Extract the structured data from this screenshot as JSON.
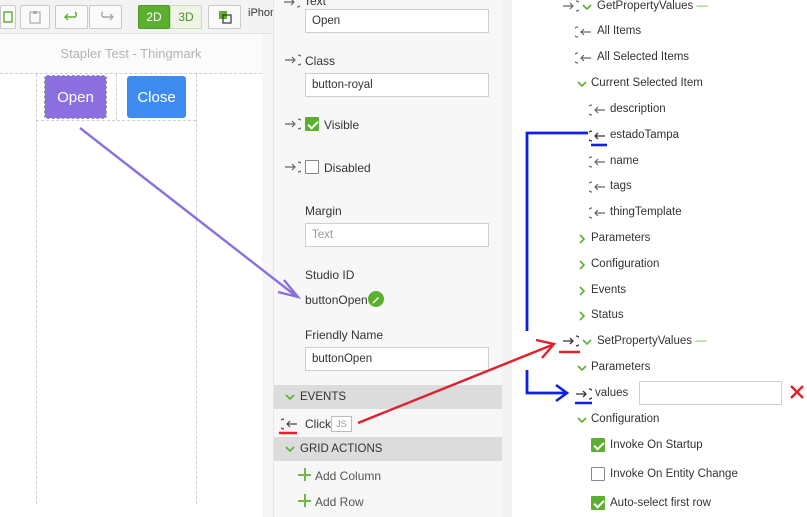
{
  "toolbar": {
    "btn_2d": "2D",
    "btn_3d": "3D",
    "device": "iPhone"
  },
  "canvas": {
    "title": "Stapler Test - Thingmark",
    "open_label": "Open",
    "close_label": "Close",
    "colors": {
      "open": "#8b6fe0",
      "close": "#3e8cf0"
    }
  },
  "properties": {
    "text_label": "Text",
    "text_value": "Open",
    "class_label": "Class",
    "class_value": "button-royal",
    "visible_label": "Visible",
    "visible_checked": true,
    "disabled_label": "Disabled",
    "disabled_checked": false,
    "margin_label": "Margin",
    "margin_placeholder": "Text",
    "studio_id_label": "Studio ID",
    "studio_id_value": "buttonOpen",
    "friendly_name_label": "Friendly Name",
    "friendly_name_value": "buttonOpen",
    "events_header": "EVENTS",
    "click_label": "Click",
    "js_badge": "JS",
    "grid_actions_header": "GRID ACTIONS",
    "add_column": "Add Column",
    "add_row": "Add Row"
  },
  "tree": {
    "get_property_values": "GetPropertyValues",
    "all_items": "All Items",
    "all_selected_items": "All Selected Items",
    "current_selected_item": "Current Selected Item",
    "fields": [
      "description",
      "estadoTampa",
      "name",
      "tags",
      "thingTemplate"
    ],
    "parameters": "Parameters",
    "configuration": "Configuration",
    "events": "Events",
    "status": "Status",
    "set_property_values": "SetPropertyValues",
    "set_parameters": "Parameters",
    "values": "values",
    "set_configuration": "Configuration",
    "invoke_on_startup": "Invoke On Startup",
    "invoke_on_startup_checked": true,
    "invoke_on_entity_change": "Invoke On Entity Change",
    "invoke_on_entity_change_checked": false,
    "auto_select_first_row": "Auto-select first row",
    "auto_select_first_row_checked": true,
    "dash": "—"
  },
  "colors": {
    "accent_green": "#5cb030",
    "annotation_purple": "#8b6fe0",
    "annotation_red": "#e0202a",
    "annotation_blue": "#1020e0"
  }
}
